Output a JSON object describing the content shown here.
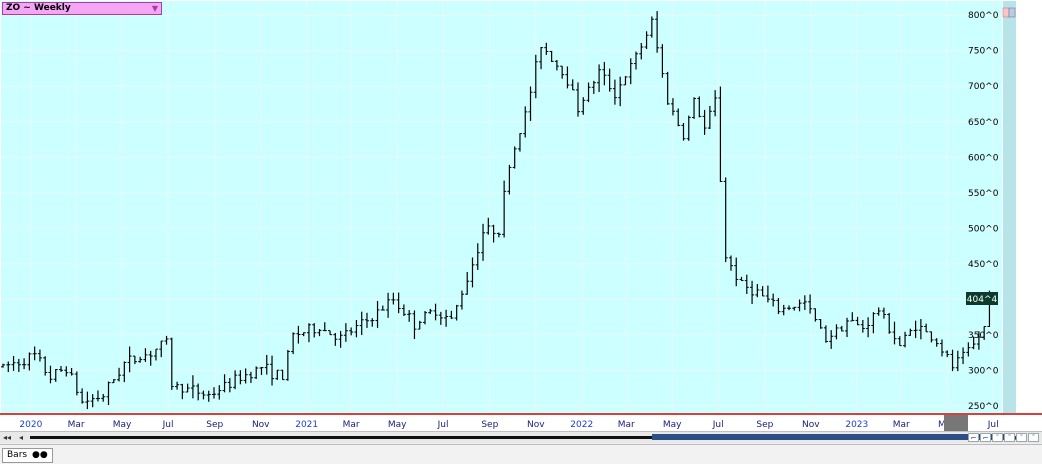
{
  "symbol": {
    "label": "ZO ~ Weekly",
    "dropdown_icon": "triangle-down-icon"
  },
  "bottom_tab": {
    "label": "Bars",
    "dots": "●●"
  },
  "scrollbar": {
    "left": "◂◂",
    "prev": "◂",
    "next": "▸"
  },
  "colors": {
    "plot_bg": "#ccffff",
    "bars": "#000000",
    "axis_line": "#cc0000",
    "price_box": "#0d3a2a",
    "right_strip": "#b7e4e8"
  },
  "chart_data": {
    "type": "ohlc",
    "ylim": [
      240,
      820
    ],
    "y_ticks": [
      {
        "v": 800,
        "label": "800^0"
      },
      {
        "v": 750,
        "label": "750^0"
      },
      {
        "v": 700,
        "label": "700^0"
      },
      {
        "v": 650,
        "label": "650^0"
      },
      {
        "v": 600,
        "label": "600^0"
      },
      {
        "v": 550,
        "label": "550^0"
      },
      {
        "v": 500,
        "label": "500^0"
      },
      {
        "v": 450,
        "label": "450^0"
      },
      {
        "v": 400,
        "label": "400^0"
      },
      {
        "v": 350,
        "label": "350^0"
      },
      {
        "v": 300,
        "label": "300^0"
      },
      {
        "v": 250,
        "label": "250^0"
      }
    ],
    "x_ticks": [
      {
        "date": "2020-01-01",
        "label": "2020",
        "year": true
      },
      {
        "date": "2020-03-01",
        "label": "Mar"
      },
      {
        "date": "2020-05-01",
        "label": "May"
      },
      {
        "date": "2020-07-01",
        "label": "Jul"
      },
      {
        "date": "2020-09-01",
        "label": "Sep"
      },
      {
        "date": "2020-11-01",
        "label": "Nov"
      },
      {
        "date": "2021-01-01",
        "label": "2021",
        "year": true
      },
      {
        "date": "2021-03-01",
        "label": "Mar"
      },
      {
        "date": "2021-05-01",
        "label": "May"
      },
      {
        "date": "2021-07-01",
        "label": "Jul"
      },
      {
        "date": "2021-09-01",
        "label": "Sep"
      },
      {
        "date": "2021-11-01",
        "label": "Nov"
      },
      {
        "date": "2022-01-01",
        "label": "2022",
        "year": true
      },
      {
        "date": "2022-03-01",
        "label": "Mar"
      },
      {
        "date": "2022-05-01",
        "label": "May"
      },
      {
        "date": "2022-07-01",
        "label": "Jul"
      },
      {
        "date": "2022-09-01",
        "label": "Sep"
      },
      {
        "date": "2022-11-01",
        "label": "Nov"
      },
      {
        "date": "2023-01-01",
        "label": "2023",
        "year": true
      },
      {
        "date": "2023-03-01",
        "label": "Mar"
      },
      {
        "date": "2023-05-01",
        "label": "May"
      },
      {
        "date": "2023-07-01",
        "label": "Jul"
      }
    ],
    "last_price_label": "404^4",
    "last_price": 404.5,
    "start_date": "2019-11-25",
    "close_path": [
      [
        "2019-11-25",
        305
      ],
      [
        "2020-01-06",
        320
      ],
      [
        "2020-01-27",
        290
      ],
      [
        "2020-02-17",
        305
      ],
      [
        "2020-03-09",
        255
      ],
      [
        "2020-04-06",
        265
      ],
      [
        "2020-05-04",
        310
      ],
      [
        "2020-06-08",
        325
      ],
      [
        "2020-06-29",
        340
      ],
      [
        "2020-07-06",
        280
      ],
      [
        "2020-08-24",
        265
      ],
      [
        "2020-10-05",
        290
      ],
      [
        "2020-11-02",
        305
      ],
      [
        "2020-11-30",
        290
      ],
      [
        "2020-12-14",
        350
      ],
      [
        "2021-01-18",
        360
      ],
      [
        "2021-02-15",
        345
      ],
      [
        "2021-03-29",
        375
      ],
      [
        "2021-04-26",
        400
      ],
      [
        "2021-05-24",
        365
      ],
      [
        "2021-06-21",
        385
      ],
      [
        "2021-07-12",
        370
      ],
      [
        "2021-08-09",
        450
      ],
      [
        "2021-08-23",
        495
      ],
      [
        "2021-09-13",
        500
      ],
      [
        "2021-09-27",
        590
      ],
      [
        "2021-10-18",
        660
      ],
      [
        "2021-11-08",
        760
      ],
      [
        "2021-12-13",
        710
      ],
      [
        "2021-12-27",
        670
      ],
      [
        "2022-01-24",
        720
      ],
      [
        "2022-02-14",
        690
      ],
      [
        "2022-03-14",
        740
      ],
      [
        "2022-04-04",
        790
      ],
      [
        "2022-04-25",
        680
      ],
      [
        "2022-05-16",
        630
      ],
      [
        "2022-05-30",
        680
      ],
      [
        "2022-06-13",
        640
      ],
      [
        "2022-06-27",
        680
      ],
      [
        "2022-07-11",
        460
      ],
      [
        "2022-08-01",
        420
      ],
      [
        "2022-08-22",
        410
      ],
      [
        "2022-09-19",
        385
      ],
      [
        "2022-10-24",
        395
      ],
      [
        "2022-11-21",
        345
      ],
      [
        "2022-12-19",
        370
      ],
      [
        "2023-01-09",
        360
      ],
      [
        "2023-01-30",
        385
      ],
      [
        "2023-02-27",
        335
      ],
      [
        "2023-03-20",
        365
      ],
      [
        "2023-04-17",
        340
      ],
      [
        "2023-05-08",
        305
      ],
      [
        "2023-06-05",
        335
      ],
      [
        "2023-06-19",
        360
      ],
      [
        "2023-06-26",
        404.5
      ]
    ],
    "weekly_range_estimate": 22
  }
}
